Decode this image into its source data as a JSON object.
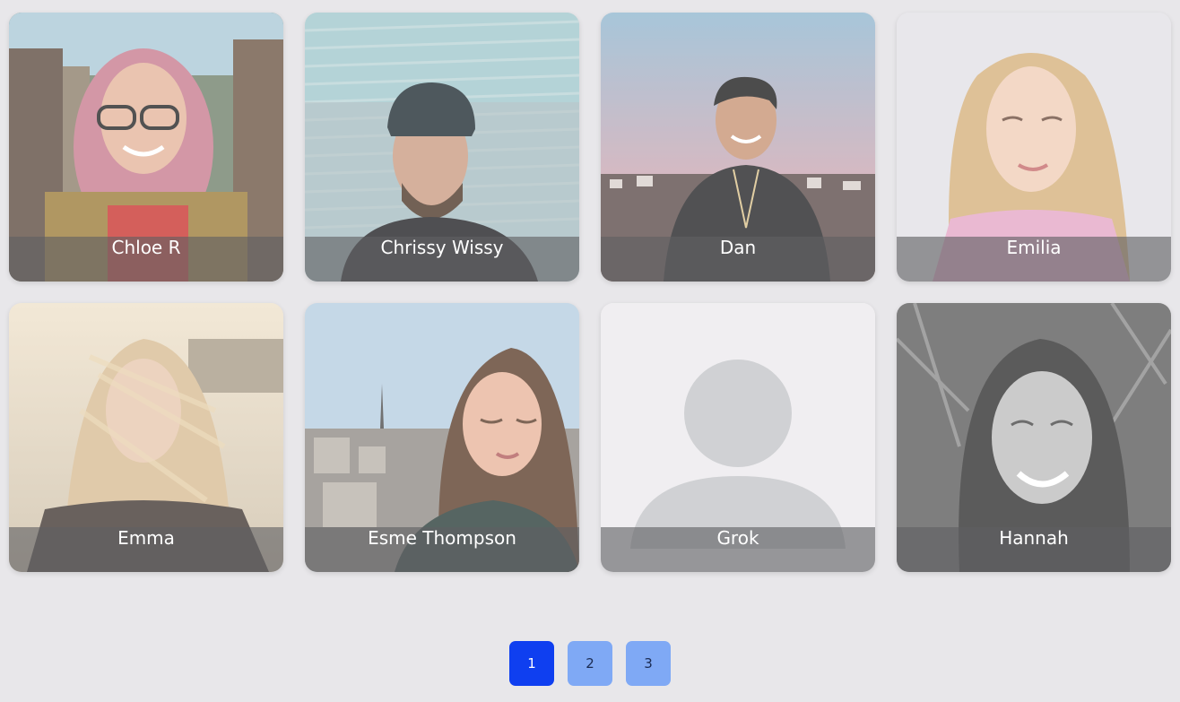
{
  "profiles": [
    {
      "name": "Chloe R",
      "photo": "photo-woman-glasses-rainbow-hair"
    },
    {
      "name": "Chrissy Wissy",
      "photo": "photo-man-cap-beard"
    },
    {
      "name": "Dan",
      "photo": "photo-man-smiling-sunset"
    },
    {
      "name": "Emilia",
      "photo": "photo-woman-blonde-pink-top"
    },
    {
      "name": "Emma",
      "photo": "photo-woman-long-hair-beach"
    },
    {
      "name": "Esme Thompson",
      "photo": "photo-woman-paris-eiffel"
    },
    {
      "name": "Grok",
      "photo": "default-avatar-icon"
    },
    {
      "name": "Hannah",
      "photo": "photo-woman-black-white-smiling"
    }
  ],
  "pagination": {
    "pages": [
      "1",
      "2",
      "3"
    ],
    "current": "1",
    "active_color": "#0f3ff0",
    "inactive_color": "#7fa9f5"
  },
  "colors": {
    "background": "#e8e7ea",
    "caption_overlay": "#5f5f62"
  }
}
